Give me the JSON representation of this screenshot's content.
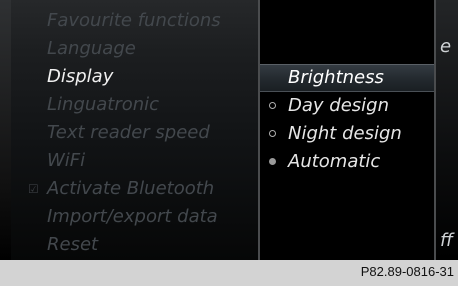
{
  "left_menu": {
    "items": [
      {
        "label": "Favourite functions",
        "active": false,
        "check": ""
      },
      {
        "label": "Language",
        "active": false,
        "check": ""
      },
      {
        "label": "Display",
        "active": true,
        "check": ""
      },
      {
        "label": "Linguatronic",
        "active": false,
        "check": ""
      },
      {
        "label": "Text reader speed",
        "active": false,
        "check": ""
      },
      {
        "label": "WiFi",
        "active": false,
        "check": ""
      },
      {
        "label": "Activate Bluetooth",
        "active": false,
        "check": "☑"
      },
      {
        "label": "Import/export data",
        "active": false,
        "check": ""
      },
      {
        "label": "Reset",
        "active": false,
        "check": ""
      }
    ]
  },
  "display_menu": {
    "items": [
      {
        "label": "Brightness",
        "highlighted": true,
        "radio": "none"
      },
      {
        "label": "Day design",
        "highlighted": false,
        "radio": "empty"
      },
      {
        "label": "Night design",
        "highlighted": false,
        "radio": "empty"
      },
      {
        "label": "Automatic",
        "highlighted": false,
        "radio": "selected"
      }
    ]
  },
  "right_panel": {
    "letters": [
      "e",
      "ff"
    ]
  },
  "footer": {
    "code": "P82.89-0816-31"
  },
  "colors": {
    "active_text": "#f0f0f0",
    "inactive_text": "#43484d",
    "highlight_bg": "#2b3137",
    "footer_bg": "#d3d3d3"
  }
}
